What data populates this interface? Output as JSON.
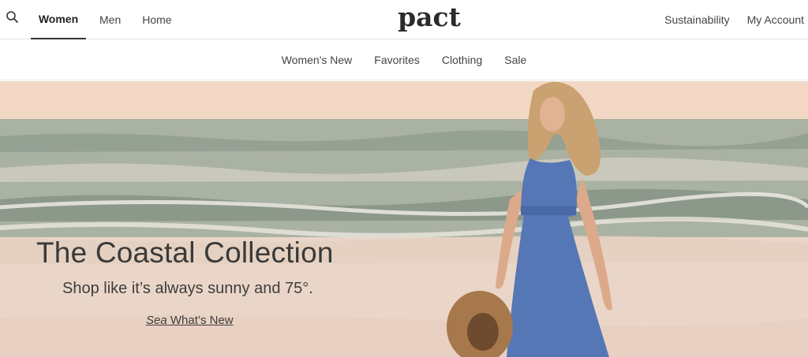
{
  "header": {
    "search_icon": "search-icon",
    "nav_left": [
      "Women",
      "Men",
      "Home"
    ],
    "logo": "pact",
    "nav_right": [
      "Sustainability",
      "My Account"
    ]
  },
  "subnav": {
    "items": [
      "Women's New",
      "Favorites",
      "Clothing",
      "Sale"
    ]
  },
  "hero": {
    "title": "The Coastal Collection",
    "subtitle": "Shop like it’s always sunny and 75°.",
    "cta_prefix": "Sea",
    "cta_rest": " What’s New"
  },
  "colors": {
    "text": "#333333",
    "active_underline": "#333333",
    "sky": "#f3d9c4",
    "sea": "#9aa597",
    "dress": "#5677b5",
    "hat": "#a8784d"
  }
}
